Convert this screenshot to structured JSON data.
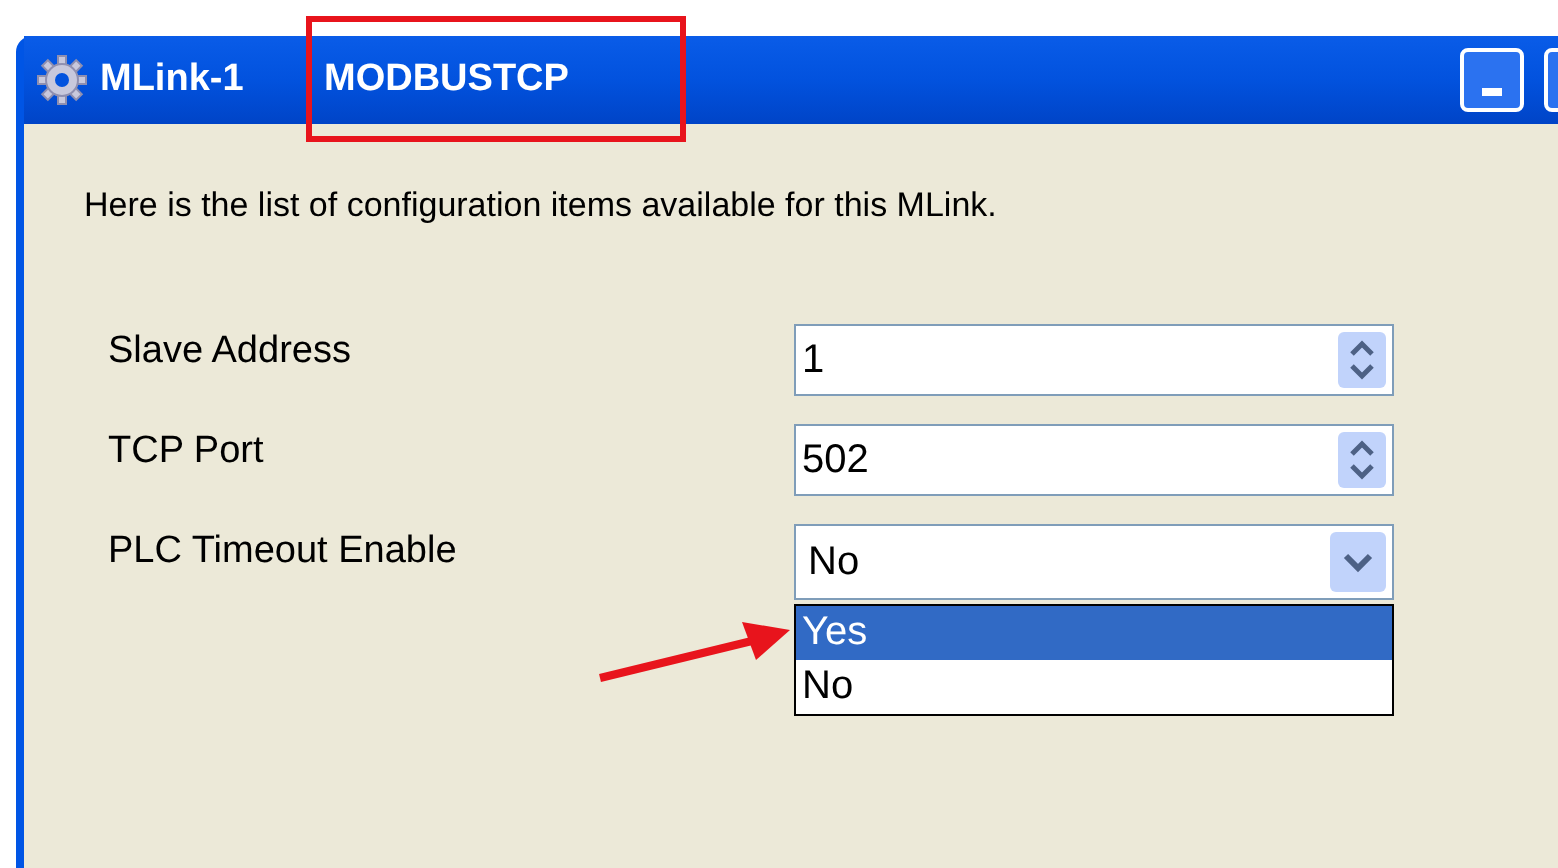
{
  "window": {
    "title_prefix": "MLink-1",
    "title": "MODBUSTCP"
  },
  "intro": "Here is the list of configuration items available for this MLink.",
  "items": [
    {
      "label": "Slave Address",
      "kind": "spin",
      "value": "1"
    },
    {
      "label": "TCP Port",
      "kind": "spin",
      "value": "502"
    },
    {
      "label": "PLC Timeout Enable",
      "kind": "dropdown",
      "value": "No",
      "expanded": true,
      "options": [
        {
          "label": "Yes",
          "highlighted": true
        },
        {
          "label": "No",
          "highlighted": false
        }
      ]
    }
  ]
}
